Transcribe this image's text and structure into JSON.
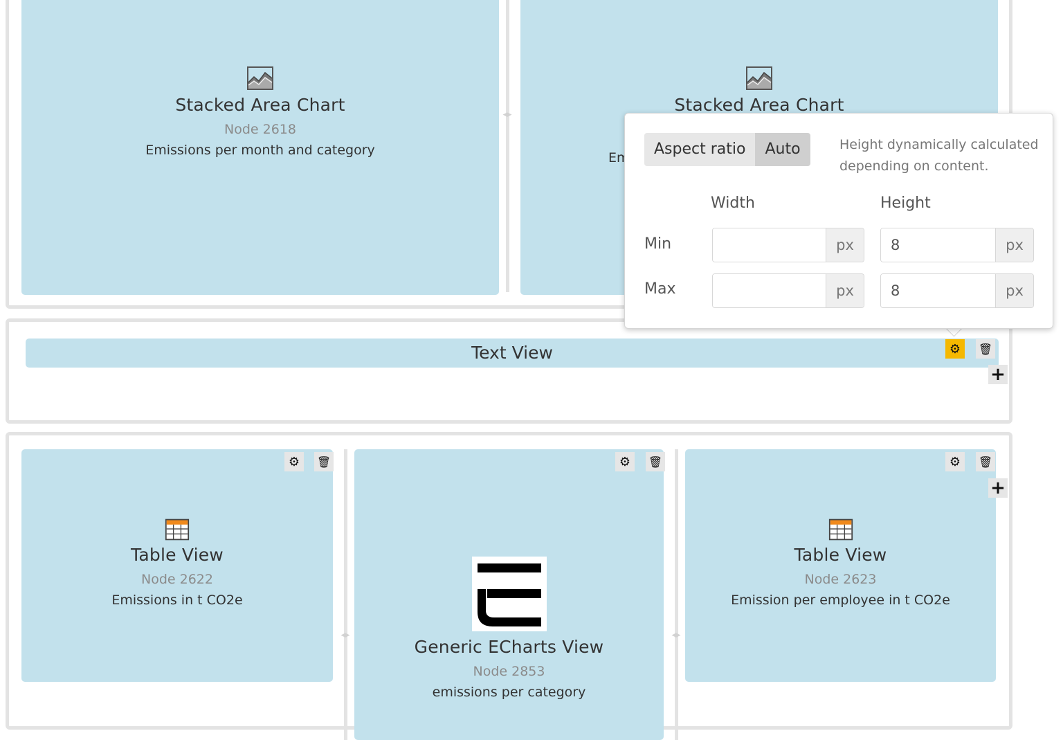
{
  "rows": {
    "top": {
      "left_view": {
        "title": "Stacked Area Chart",
        "node": "Node 2618",
        "description": "Emissions per month and category",
        "icon": "stacked-area-chart-icon"
      },
      "right_view": {
        "title": "Stacked Area Chart",
        "description_partial": "Em",
        "icon": "stacked-area-chart-icon"
      }
    },
    "middle": {
      "text_view": {
        "title": "Text View"
      }
    },
    "bottom": {
      "left_view": {
        "title": "Table View",
        "node": "Node 2622",
        "description": "Emissions in t CO2e",
        "icon": "table-icon"
      },
      "center_view": {
        "title": "Generic ECharts View",
        "node": "Node 2853",
        "description": "emissions per category",
        "icon": "echarts-logo-icon"
      },
      "right_view": {
        "title": "Table View",
        "node": "Node 2623",
        "description": "Emission per employee in t CO2e",
        "icon": "table-icon"
      }
    }
  },
  "popover": {
    "toggle": {
      "option_1": "Aspect ratio",
      "option_2": "Auto",
      "selected": "Auto"
    },
    "note": "Height dynamically calculated depending on content.",
    "columns": {
      "width": "Width",
      "height": "Height"
    },
    "rows": {
      "min": "Min",
      "max": "Max"
    },
    "unit": "px",
    "fields": {
      "min_width": "",
      "min_height": "8",
      "max_width": "",
      "max_height": "8"
    }
  },
  "controls": {
    "settings_glyph": "⚙",
    "delete_glyph": "🗑",
    "add_glyph": "+"
  },
  "colors": {
    "view_bg": "#c2e1ec",
    "active_settings": "#f5b800",
    "row_border": "#e3e3e3"
  }
}
